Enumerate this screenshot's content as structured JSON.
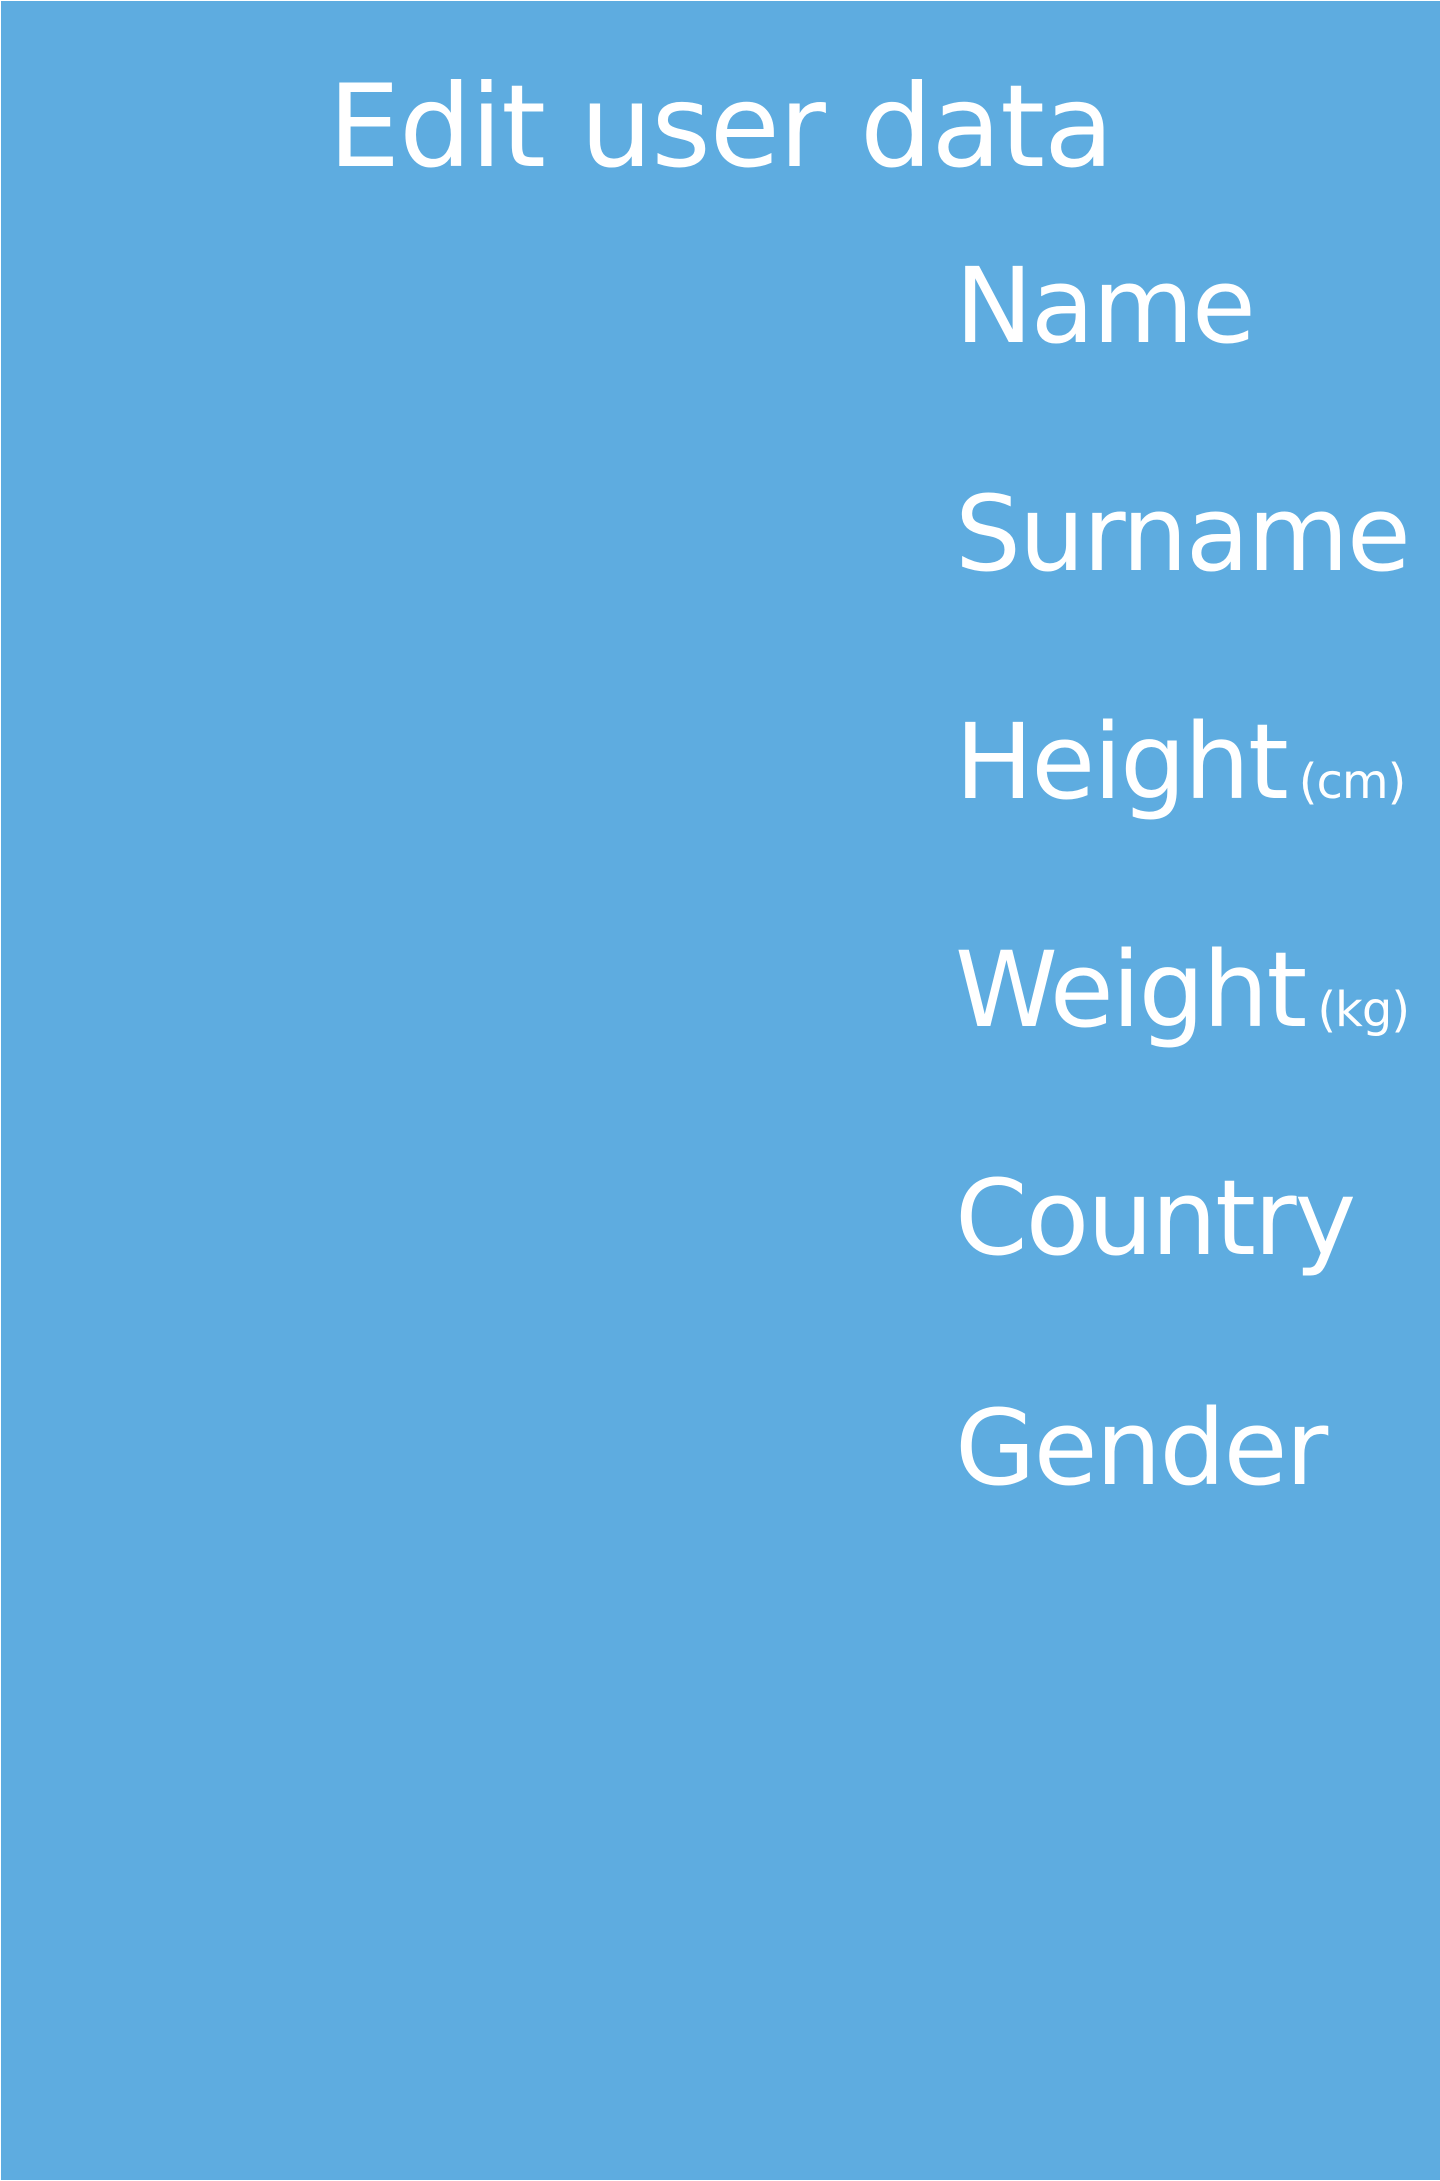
{
  "colors": {
    "background": "#5eace0",
    "text": "#ffffff"
  },
  "page": {
    "title": "Edit user data"
  },
  "fields": [
    {
      "label": "Name",
      "unit": ""
    },
    {
      "label": "Surname",
      "unit": ""
    },
    {
      "label": "Height",
      "unit": "(cm)"
    },
    {
      "label": "Weight",
      "unit": "(kg)"
    },
    {
      "label": "Country",
      "unit": ""
    },
    {
      "label": "Gender",
      "unit": ""
    }
  ]
}
